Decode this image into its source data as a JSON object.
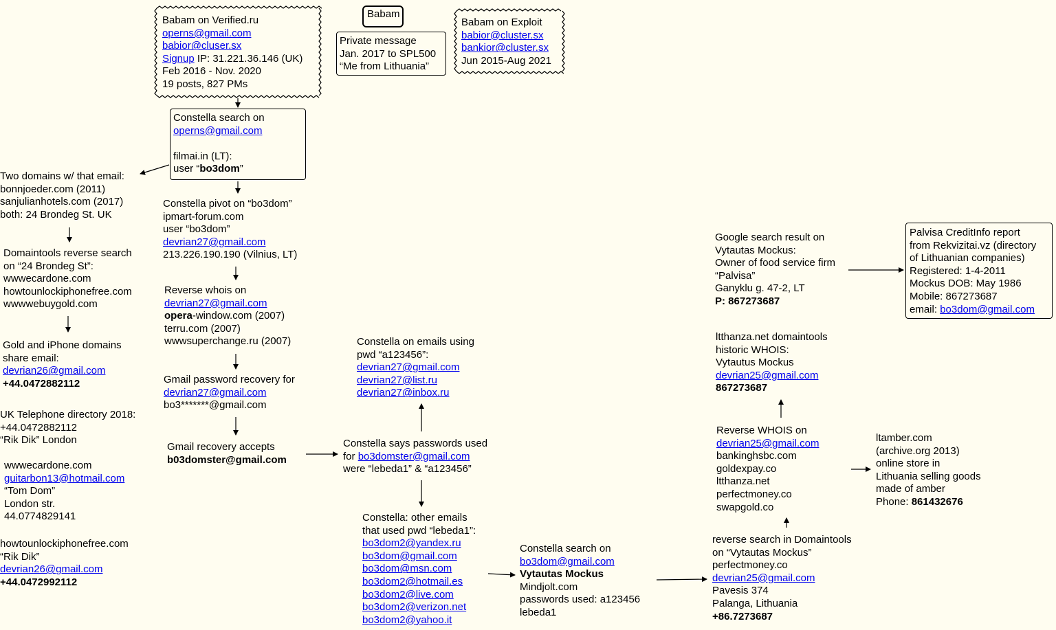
{
  "colors": {
    "background": "#fffdf0",
    "link": "#0000ee",
    "line": "#000000"
  },
  "babam_title": "Babam",
  "verified": {
    "title": "Babam on Verified.ru",
    "email1": "operns@gmail.com",
    "email2": "babior@cluser.sx",
    "signup_link": "Signup",
    "signup_rest": " IP: 31.221.36.146 (UK)",
    "dates": "Feb 2016 - Nov. 2020",
    "posts": "19 posts, 827 PMs"
  },
  "private_msg": {
    "l1": "Private message",
    "l2": "Jan. 2017 to SPL500",
    "l3": "“Me from Lithuania”"
  },
  "exploit": {
    "title": "Babam on Exploit",
    "email1": "babior@cluster.sx",
    "email2": "bankior@cluster.sx",
    "dates": "Jun 2015-Aug 2021"
  },
  "constella1": {
    "l1": "Constella search on",
    "email": "operns@gmail.com",
    "l3": "filmai.in (LT):",
    "l4_pre": "user “",
    "l4_bold": "bo3dom",
    "l4_post": "”"
  },
  "two_domains": {
    "l1": "Two domains w/ that email:",
    "l2": "bonnjoeder.com (2011)",
    "l3": "sanjulianhotels.com (2017)",
    "l4": "both: 24 Brondeg St. UK"
  },
  "domaintools_rev": {
    "l1": "Domaintools reverse search",
    "l2": "on “24 Brondeg St”:",
    "l3": "wwwecardone.com",
    "l4": "howtounlockiphonefree.com",
    "l5": "wwwwebuygold.com"
  },
  "gold_iphone": {
    "l1": "Gold and iPhone domains",
    "l2": "share email:",
    "email": "devrian26@gmail.com",
    "phone": "+44.0472882112"
  },
  "uk_directory": {
    "l1": "UK Telephone directory 2018:",
    "l2": "+44.0472882112",
    "l3": "“Rik Dik” London"
  },
  "wwwecardone": {
    "l1": "wwwecardone.com",
    "email": "guitarbon13@hotmail.com",
    "l3": "“Tom Dom”",
    "l4": "London str.",
    "l5": "44.0774829141"
  },
  "howtounlock": {
    "l1": "howtounlockiphonefree.com",
    "l2": "“Rik Dik”",
    "email": "devrian26@gmail.com",
    "phone": "+44.0472992112"
  },
  "pivot": {
    "l1": "Constella pivot on “bo3dom”",
    "l2": "ipmart-forum.com",
    "l3": "user “bo3dom”",
    "email": "devrian27@gmail.com",
    "l5": "213.226.190.190 (Vilnius, LT)"
  },
  "rev_whois": {
    "l1": "Reverse whois on",
    "email": "devrian27@gmail.com",
    "l3_bold": "opera",
    "l3_rest": "-window.com (2007)",
    "l4": "terru.com (2007)",
    "l5": "wwwsuperchange.ru (2007)"
  },
  "gmail_recovery": {
    "l1": "Gmail password recovery for",
    "email": "devrian27@gmail.com",
    "l3": "bo3*******@gmail.com"
  },
  "gmail_accepts": {
    "l1": "Gmail recovery accepts",
    "l2": "b03domster@gmail.com"
  },
  "constella_pwd": {
    "l1": "Constella on emails using",
    "l2": "pwd “a123456”:",
    "e1": "devrian27@gmail.com",
    "e2": "devrian27@list.ru",
    "e3": "devrian27@inbox.ru"
  },
  "constella_says": {
    "l1": "Constella says passwords used",
    "l2_pre": "for ",
    "email": "bo3domster@gmail.com",
    "l3": "were “lebeda1” & “a123456”"
  },
  "constella_other": {
    "l1": "Constella: other emails",
    "l2": "that used pwd “lebeda1”:",
    "emails": [
      "bo3dom2@yandex.ru",
      "bo3dom@gmail.com",
      "bo3dom@msn.com",
      "bo3dom2@hotmail.es",
      "bo3dom2@live.com",
      "bo3dom2@verizon.net",
      "bo3dom2@yahoo.it"
    ]
  },
  "constella_search": {
    "l1": "Constella search on",
    "email": "bo3dom@gmail.com",
    "l3": "Vytautas Mockus",
    "l4": "Mindjolt.com",
    "l5": "passwords used: a123456",
    "l6": "lebeda1"
  },
  "reverse_search": {
    "l1": "reverse search in Domaintools",
    "l2": "on “Vytautas Mockus”",
    "l3": "perfectmoney.co",
    "email": "devrian25@gmail.com",
    "l5": "Pavesis 374",
    "l6": "Palanga, Lithuania",
    "phone": "+86.7273687"
  },
  "rev_whois2": {
    "l1": "Reverse WHOIS on",
    "email": "devrian25@gmail.com",
    "domains": [
      "bankinghsbc.com",
      "goldexpay.co",
      "ltthanza.net",
      "perfectmoney.co",
      "swapgold.co"
    ]
  },
  "ltthanza": {
    "l1": "ltthanza.net domaintools",
    "l2": "historic WHOIS:",
    "l3": "Vytautus Mockus",
    "email": "devrian25@gmail.com",
    "phone": "867273687"
  },
  "google": {
    "l1": "Google search result on",
    "l2": "Vytautas Mockus:",
    "l3": "Owner of food service firm",
    "l4": "“Palvisa”",
    "l5": "Ganyklu g. 47-2, LT",
    "phone": "P: 867273687"
  },
  "palvisa": {
    "l1": "Palvisa CreditInfo report",
    "l2": "from Rekvizitai.vz (directory",
    "l3": "of Lithuanian companies)",
    "l4": "Registered: 1-4-2011",
    "l5": "Mockus DOB: May 1986",
    "l6": "Mobile: 867273687",
    "email_pre": "email: ",
    "email": "bo3dom@gmail.com"
  },
  "ltamber": {
    "l1": "ltamber.com",
    "l2": "(archive.org 2013)",
    "l3": "online store in",
    "l4": "Lithuania selling goods",
    "l5": "made of amber",
    "phone_pre": "Phone: ",
    "phone": "861432676"
  }
}
